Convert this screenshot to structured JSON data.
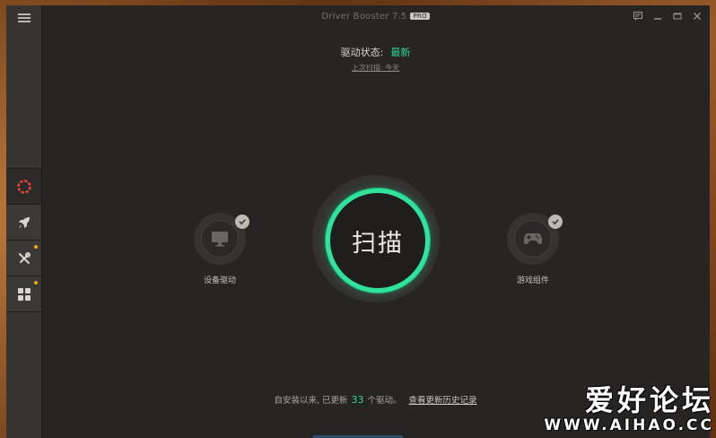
{
  "app": {
    "title": "Driver Booster 7.5",
    "badge": "PRO"
  },
  "status": {
    "label": "驱动状态:",
    "value": "最新",
    "last_scan": "上次扫描: 今天"
  },
  "scan": {
    "label": "扫描"
  },
  "features": {
    "left": {
      "label": "设备驱动",
      "icon": "monitor-icon"
    },
    "right": {
      "label": "游戏组件",
      "icon": "gamepad-icon"
    }
  },
  "footer": {
    "prefix": "自安装以来, 已更新",
    "count": "33",
    "suffix": "个驱动。",
    "link": "查看更新历史记录"
  },
  "sidebar": {
    "items": [
      {
        "icon": "scan-ring-icon",
        "active": true,
        "dot": false
      },
      {
        "icon": "rocket-icon",
        "active": false,
        "dot": false
      },
      {
        "icon": "tools-icon",
        "active": false,
        "dot": true
      },
      {
        "icon": "grid-icon",
        "active": false,
        "dot": true
      }
    ]
  },
  "watermark": {
    "main": "爱好论坛",
    "sub": "WWW.AIHAO.CC"
  },
  "colors": {
    "accent": "#2fe39a",
    "background": "#262523",
    "sidebar": "#363532",
    "active_icon": "#e8433c",
    "notify_dot": "#f2a51e"
  }
}
